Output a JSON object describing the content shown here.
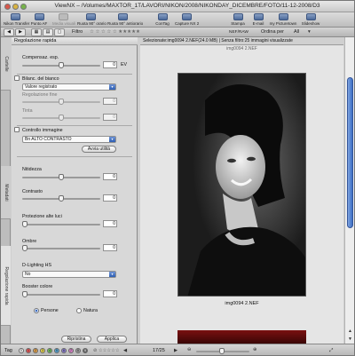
{
  "window": {
    "title": "ViewNX – /Volumes/MAXTOR_1T/LAVORI/NIKON/2008/NIKONDAY_DICEMBRE/FOTO/11-12-2008/D3"
  },
  "toolbar": {
    "items": [
      {
        "label": "Nikon Transfer",
        "icon": "transfer-icon",
        "enabled": true
      },
      {
        "label": "Punto AF",
        "icon": "af-point-icon",
        "enabled": true
      },
      {
        "label": "Media visuali",
        "icon": "media-icon",
        "enabled": false
      },
      {
        "label": "Ruota 90° orario",
        "icon": "rotate-cw-icon",
        "enabled": true
      },
      {
        "label": "Ruota 90° antiorario",
        "icon": "rotate-ccw-icon",
        "enabled": true
      },
      {
        "label": "ConTag",
        "icon": "tag-icon",
        "enabled": true
      },
      {
        "label": "Capture NX 2",
        "icon": "capture-nx-icon",
        "enabled": true
      },
      {
        "label": "Stampa",
        "icon": "print-icon",
        "enabled": true
      },
      {
        "label": "E-mail",
        "icon": "email-icon",
        "enabled": true
      },
      {
        "label": "my Picturetown",
        "icon": "picturetown-icon",
        "enabled": true
      },
      {
        "label": "Slideshow",
        "icon": "slideshow-icon",
        "enabled": true
      }
    ]
  },
  "navbar": {
    "filter_label": "Filtro",
    "raw_label": "NEF/RAW",
    "sort_label": "Ordina per",
    "sort_value": "All"
  },
  "vtabs": {
    "tab1": "Cartelle",
    "tab2": "Metadati",
    "tab3": "Regolazione rapida"
  },
  "panel": {
    "title": "Regolazione rapida",
    "exposure": {
      "label": "Compensaz. esp.",
      "value": "0",
      "unit": "EV"
    },
    "white_balance": {
      "label": "Bilanc. del bianco",
      "selected": "Valore registrato"
    },
    "fine_tune": {
      "label": "Regolazione fine",
      "value": "0"
    },
    "tint": {
      "label": "Tinta",
      "value": "0"
    },
    "picture_control": {
      "label": "Controllo immagine",
      "selected": "Bn ALTO CONTRASTO",
      "button": "Avvia utilità"
    },
    "sharpness": {
      "label": "Nitidezza",
      "value": "0"
    },
    "contrast": {
      "label": "Contrasto",
      "value": "0"
    },
    "highlights": {
      "label": "Protezione alte luci",
      "value": "0"
    },
    "shadows": {
      "label": "Ombre",
      "value": "0"
    },
    "dlighting": {
      "label": "D-Lighting HS",
      "selected": "No"
    },
    "color_booster": {
      "label": "Booster colore",
      "value": "0"
    },
    "booster_people": "Persone",
    "booster_nature": "Natura",
    "reset_button": "Ripristina",
    "apply_button": "Applica"
  },
  "pane": {
    "info": "Selezionate:img0094 2.NEF(24.0 MB) | Senza filtro:25 immagini visualizzate",
    "sub_caption": "img0094 2.NEF",
    "caption": "img0094 2.NEF"
  },
  "status": {
    "tag_label": "Tag",
    "tags": [
      "0",
      "1",
      "2",
      "3",
      "4",
      "5",
      "6",
      "7",
      "8",
      "9"
    ],
    "counter": "17/25"
  }
}
